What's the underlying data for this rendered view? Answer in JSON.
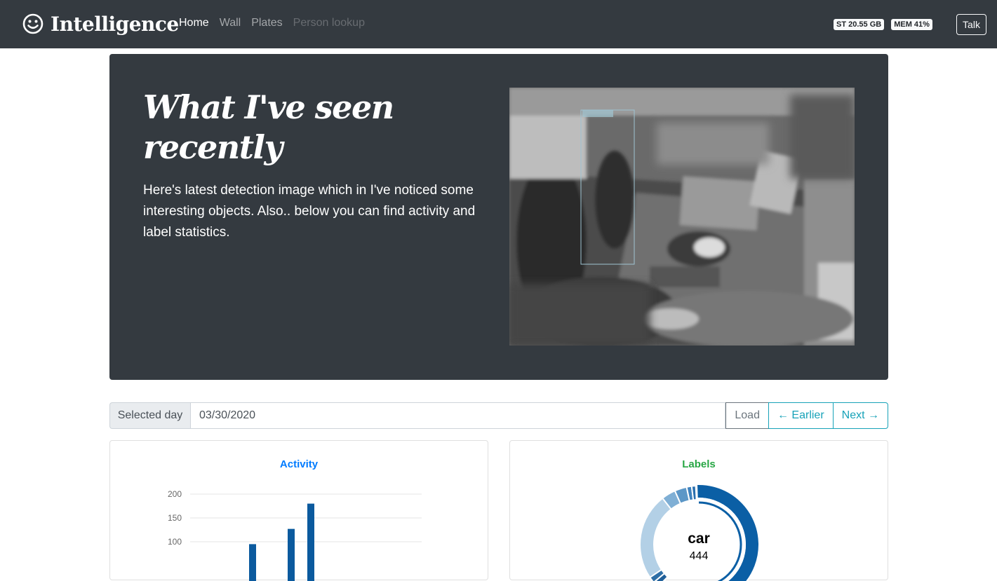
{
  "navbar": {
    "brand": "Intelligence",
    "links": [
      {
        "label": "Home",
        "state": "active"
      },
      {
        "label": "Wall",
        "state": "normal"
      },
      {
        "label": "Plates",
        "state": "normal"
      },
      {
        "label": "Person lookup",
        "state": "disabled"
      }
    ],
    "badges": {
      "storage": "ST 20.55 GB",
      "memory": "MEM 41%"
    },
    "talk_label": "Talk"
  },
  "hero": {
    "title": "What I've seen recently",
    "lead": "Here's latest detection image which in I've noticed some interesting objects. Also.. below you can find activity and label statistics."
  },
  "day_picker": {
    "label": "Selected day",
    "value": "03/30/2020",
    "load_label": "Load",
    "earlier_label": "← Earlier",
    "next_label": "Next →"
  },
  "activity_card": {
    "title": "Activity"
  },
  "labels_card": {
    "title": "Labels",
    "center_label": "car",
    "center_value": "444"
  },
  "colors": {
    "navbar_bg": "#343a40",
    "accent_info": "#17a2b8",
    "accent_blue": "#007bff",
    "accent_green": "#28a745",
    "bar_color": "#0b5a9e"
  },
  "chart_data": [
    {
      "type": "bar",
      "title": "Activity",
      "ylim": [
        0,
        200
      ],
      "yticks": [
        100,
        150,
        200
      ],
      "bars": [
        {
          "value": 95
        },
        {
          "value": 127
        },
        {
          "value": 180
        }
      ]
    },
    {
      "type": "pie",
      "title": "Labels",
      "center_label": "car",
      "center_value": "444"
    }
  ]
}
